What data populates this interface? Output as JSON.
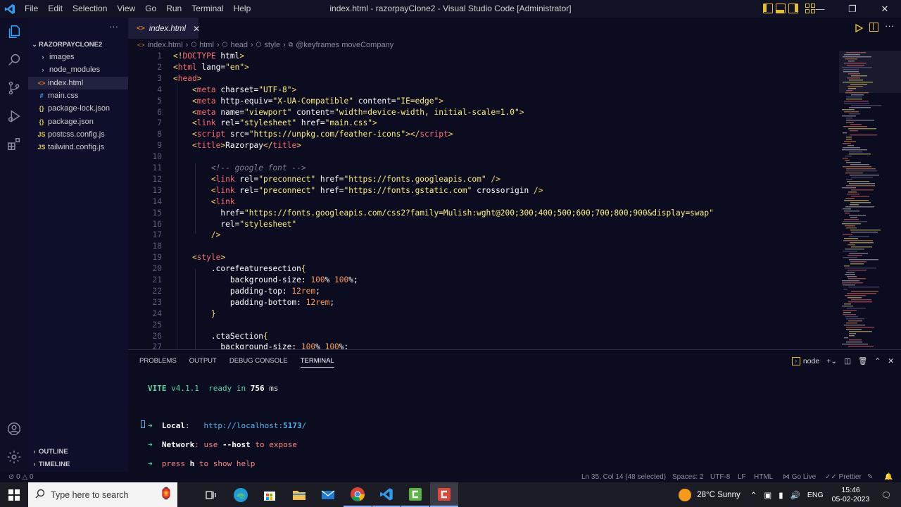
{
  "menu": [
    "File",
    "Edit",
    "Selection",
    "View",
    "Go",
    "Run",
    "Terminal",
    "Help"
  ],
  "window_title": "index.html - razorpayClone2 - Visual Studio Code [Administrator]",
  "explorer": {
    "project": "RAZORPAYCLONE2",
    "items": [
      {
        "label": "images",
        "kind": "folder"
      },
      {
        "label": "node_modules",
        "kind": "folder"
      },
      {
        "label": "index.html",
        "kind": "html",
        "active": true
      },
      {
        "label": "main.css",
        "kind": "css"
      },
      {
        "label": "package-lock.json",
        "kind": "json"
      },
      {
        "label": "package.json",
        "kind": "json"
      },
      {
        "label": "postcss.config.js",
        "kind": "js"
      },
      {
        "label": "tailwind.config.js",
        "kind": "js"
      }
    ],
    "outline": "OUTLINE",
    "timeline": "TIMELINE"
  },
  "tab": {
    "label": "index.html"
  },
  "breadcrumb": [
    "index.html",
    "html",
    "head",
    "style",
    "@keyframes moveCompany"
  ],
  "code_lines": [
    [
      [
        "br",
        "<!"
      ],
      [
        "tag",
        "DOCTYPE"
      ],
      [
        "at",
        " html"
      ],
      [
        "br",
        ">"
      ]
    ],
    [
      [
        "br",
        "<"
      ],
      [
        "tag",
        "html"
      ],
      [
        "at",
        " lang="
      ],
      [
        "st",
        "\"en\""
      ],
      [
        "br",
        ">"
      ]
    ],
    [
      [
        "br",
        "<"
      ],
      [
        "tag",
        "head"
      ],
      [
        "br",
        ">"
      ]
    ],
    [
      [
        "t",
        "    "
      ],
      [
        "br",
        "<"
      ],
      [
        "tag",
        "meta"
      ],
      [
        "at",
        " charset="
      ],
      [
        "st",
        "\"UTF-8\""
      ],
      [
        "br",
        ">"
      ]
    ],
    [
      [
        "t",
        "    "
      ],
      [
        "br",
        "<"
      ],
      [
        "tag",
        "meta"
      ],
      [
        "at",
        " http-equiv="
      ],
      [
        "st",
        "\"X-UA-Compatible\""
      ],
      [
        "at",
        " content="
      ],
      [
        "st",
        "\"IE=edge\""
      ],
      [
        "br",
        ">"
      ]
    ],
    [
      [
        "t",
        "    "
      ],
      [
        "br",
        "<"
      ],
      [
        "tag",
        "meta"
      ],
      [
        "at",
        " name="
      ],
      [
        "st",
        "\"viewport\""
      ],
      [
        "at",
        " content="
      ],
      [
        "st",
        "\"width=device-width, initial-scale=1.0\""
      ],
      [
        "br",
        ">"
      ]
    ],
    [
      [
        "t",
        "    "
      ],
      [
        "br",
        "<"
      ],
      [
        "tag",
        "link"
      ],
      [
        "at",
        " rel="
      ],
      [
        "st",
        "\"stylesheet\""
      ],
      [
        "at",
        " href="
      ],
      [
        "st",
        "\"main.css\""
      ],
      [
        "br",
        ">"
      ]
    ],
    [
      [
        "t",
        "    "
      ],
      [
        "br",
        "<"
      ],
      [
        "tag",
        "script"
      ],
      [
        "at",
        " src="
      ],
      [
        "st",
        "\"https://unpkg.com/feather-icons\""
      ],
      [
        "br",
        "></"
      ],
      [
        "tag",
        "script"
      ],
      [
        "br",
        ">"
      ]
    ],
    [
      [
        "t",
        "    "
      ],
      [
        "br",
        "<"
      ],
      [
        "tag",
        "title"
      ],
      [
        "br",
        ">"
      ],
      [
        "at",
        "Razorpay"
      ],
      [
        "br",
        "</"
      ],
      [
        "tag",
        "title"
      ],
      [
        "br",
        ">"
      ]
    ],
    [],
    [
      [
        "t",
        "        "
      ],
      [
        "cm",
        "<!-- google font -->"
      ]
    ],
    [
      [
        "t",
        "        "
      ],
      [
        "br",
        "<"
      ],
      [
        "tag",
        "link"
      ],
      [
        "at",
        " rel="
      ],
      [
        "st",
        "\"preconnect\""
      ],
      [
        "at",
        " href="
      ],
      [
        "st",
        "\"https://fonts.googleapis.com\""
      ],
      [
        "br",
        " />"
      ]
    ],
    [
      [
        "t",
        "        "
      ],
      [
        "br",
        "<"
      ],
      [
        "tag",
        "link"
      ],
      [
        "at",
        " rel="
      ],
      [
        "st",
        "\"preconnect\""
      ],
      [
        "at",
        " href="
      ],
      [
        "st",
        "\"https://fonts.gstatic.com\""
      ],
      [
        "at",
        " crossorigin"
      ],
      [
        "br",
        " />"
      ]
    ],
    [
      [
        "t",
        "        "
      ],
      [
        "br",
        "<"
      ],
      [
        "tag",
        "link"
      ]
    ],
    [
      [
        "t",
        "          "
      ],
      [
        "at",
        "href="
      ],
      [
        "st",
        "\"https://fonts.googleapis.com/css2?family=Mulish:wght@200;300;400;500;600;700;800;900&display=swap\""
      ]
    ],
    [
      [
        "t",
        "          "
      ],
      [
        "at",
        "rel="
      ],
      [
        "st",
        "\"stylesheet\""
      ]
    ],
    [
      [
        "t",
        "        "
      ],
      [
        "br",
        "/>"
      ]
    ],
    [],
    [
      [
        "t",
        "    "
      ],
      [
        "br",
        "<"
      ],
      [
        "tag",
        "style"
      ],
      [
        "br",
        ">"
      ]
    ],
    [
      [
        "t",
        "        "
      ],
      [
        "sel",
        ".corefeaturesection"
      ],
      [
        "br",
        "{"
      ]
    ],
    [
      [
        "t",
        "            "
      ],
      [
        "at",
        "background-size: "
      ],
      [
        "num",
        "100"
      ],
      [
        "at",
        "% "
      ],
      [
        "num",
        "100"
      ],
      [
        "at",
        "%;"
      ]
    ],
    [
      [
        "t",
        "            "
      ],
      [
        "at",
        "padding-top: "
      ],
      [
        "num",
        "12"
      ],
      [
        "num",
        "rem"
      ],
      [
        "at",
        ";"
      ]
    ],
    [
      [
        "t",
        "            "
      ],
      [
        "at",
        "padding-bottom: "
      ],
      [
        "num",
        "12"
      ],
      [
        "num",
        "rem"
      ],
      [
        "at",
        ";"
      ]
    ],
    [
      [
        "t",
        "        "
      ],
      [
        "br",
        "}"
      ]
    ],
    [],
    [
      [
        "t",
        "        "
      ],
      [
        "sel",
        ".ctaSection"
      ],
      [
        "br",
        "{"
      ]
    ],
    [
      [
        "t",
        "          "
      ],
      [
        "at",
        "background-size: "
      ],
      [
        "num",
        "100"
      ],
      [
        "at",
        "% "
      ],
      [
        "num",
        "100"
      ],
      [
        "at",
        "%;"
      ]
    ]
  ],
  "panel": {
    "tabs": [
      "PROBLEMS",
      "OUTPUT",
      "DEBUG CONSOLE",
      "TERMINAL"
    ],
    "active": "TERMINAL",
    "shell": "node"
  },
  "terminal": {
    "vite": "VITE",
    "version": "v4.1.1",
    "ready": "ready in",
    "ms_value": "756",
    "ms_unit": "ms",
    "local_label": "Local",
    "local_sep": ":",
    "local_url_a": "http://localhost:",
    "local_port": "5173",
    "local_url_b": "/",
    "network_label": "Network",
    "network_text": ": use ",
    "network_flag": "--host",
    "network_tail": " to expose",
    "press": "press ",
    "h": "h",
    "help": " to show help"
  },
  "status": {
    "errors": "0",
    "warnings": "0",
    "position": "Ln 35, Col 14 (48 selected)",
    "spaces": "Spaces: 2",
    "encoding": "UTF-8",
    "eol": "LF",
    "language": "HTML",
    "golive": "Go Live",
    "prettier": "Prettier"
  },
  "taskbar": {
    "search_placeholder": "Type here to search",
    "weather": "28°C  Sunny",
    "lang": "ENG",
    "time": "15:46",
    "date": "05-02-2023"
  },
  "colors": {
    "bg": "#0b0c20",
    "tag": "#ff6d6d",
    "string": "#fff27a",
    "number": "#ff9b4e",
    "vite_green": "#57d6a0",
    "accent": "#e2c12c"
  }
}
